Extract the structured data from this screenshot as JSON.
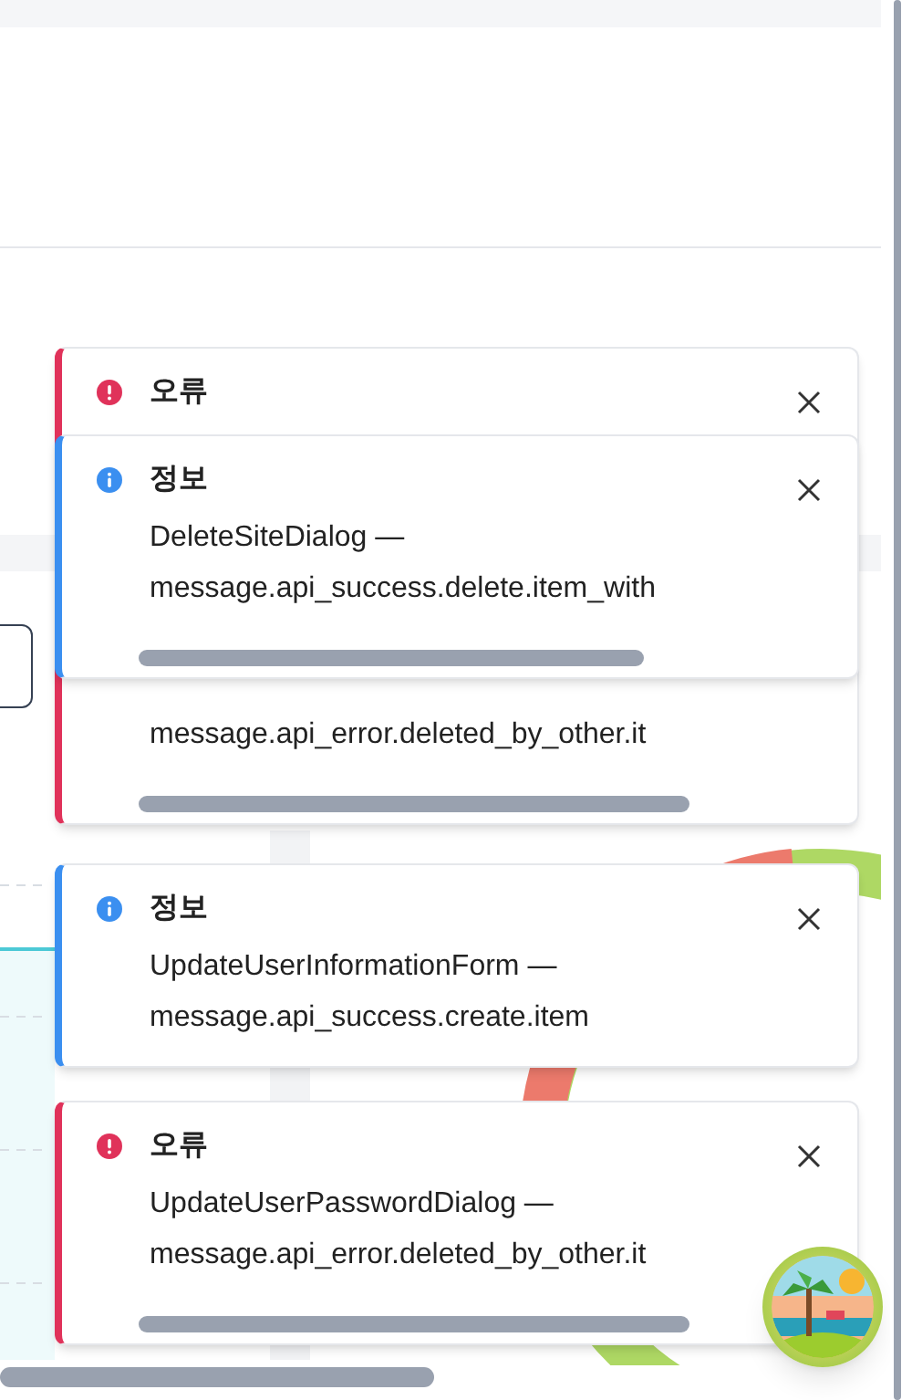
{
  "toasts": [
    {
      "kind": "error",
      "title": "오류",
      "lines": [
        "message.api_error.deleted_by_other.it"
      ]
    },
    {
      "kind": "info",
      "title": "정보",
      "lines": [
        "DeleteSiteDialog —",
        "message.api_success.delete.item_with"
      ]
    },
    {
      "kind": "info",
      "title": "정보",
      "lines": [
        "UpdateUserInformationForm —",
        "message.api_success.create.item"
      ]
    },
    {
      "kind": "error",
      "title": "오류",
      "lines": [
        "UpdateUserPasswordDialog —",
        "message.api_error.deleted_by_other.it"
      ]
    }
  ]
}
